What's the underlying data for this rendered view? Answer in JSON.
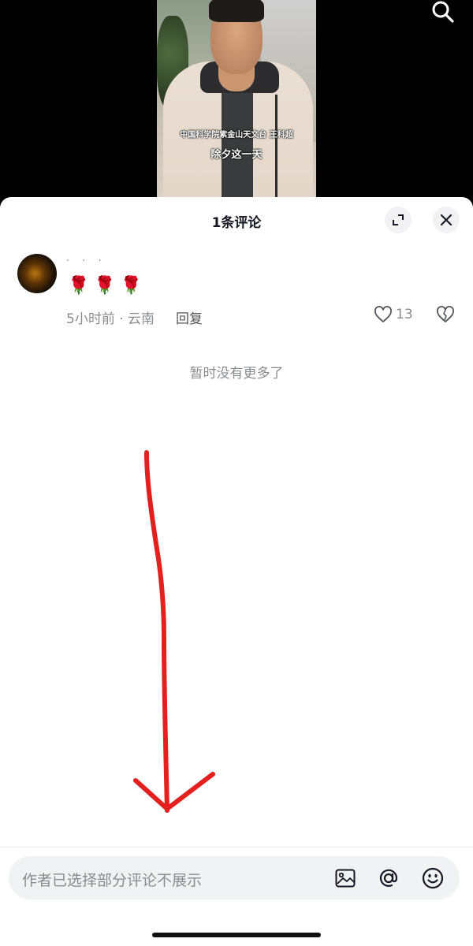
{
  "video": {
    "caption_line1": "中国科学院紫金山天文台 王科超",
    "caption_line2": "除夕这一天"
  },
  "sheet": {
    "title": "1条评论"
  },
  "comment": {
    "username": "· · ·",
    "text": "🌹🌹🌹",
    "meta": "5小时前 · 云南",
    "reply_label": "回复",
    "like_count": "13"
  },
  "footer": {
    "no_more": "暂时没有更多了"
  },
  "input": {
    "placeholder": "作者已选择部分评论不展示"
  },
  "icons": {
    "search": "search-icon",
    "expand": "expand-icon",
    "close": "close-icon",
    "like": "heart-icon",
    "dislike": "broken-heart-icon",
    "image": "image-icon",
    "mention": "at-icon",
    "emoji": "emoji-icon"
  },
  "colors": {
    "annotation_arrow": "#e3201e"
  }
}
